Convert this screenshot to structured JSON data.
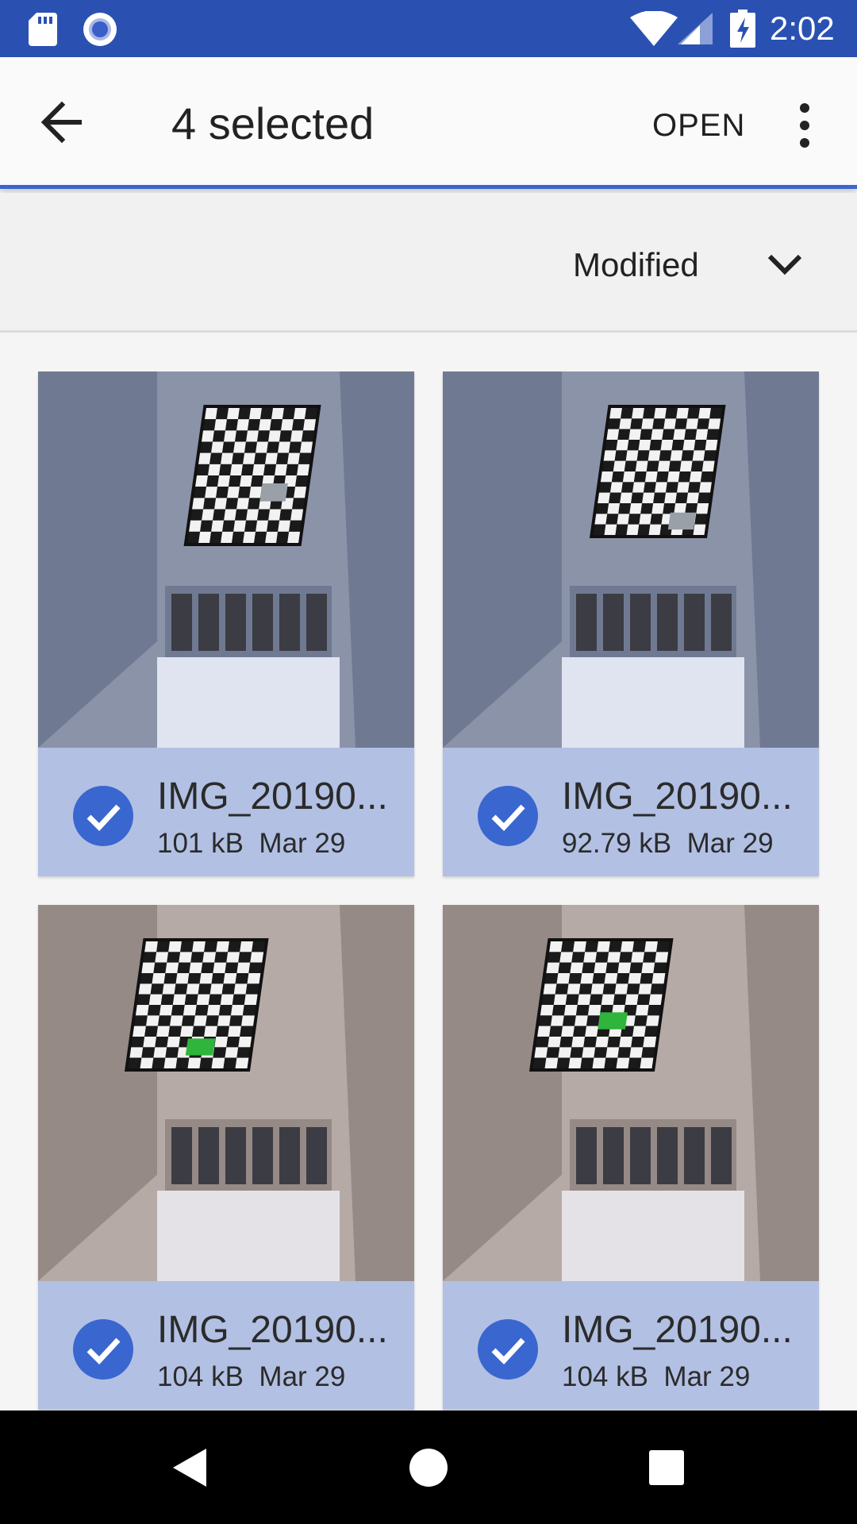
{
  "status_bar": {
    "time": "2:02",
    "icons": [
      "sd-card-icon",
      "circle-notification-icon",
      "wifi-icon",
      "cell-signal-icon",
      "battery-charging-icon"
    ]
  },
  "app_bar": {
    "title": "4 selected",
    "open_label": "OPEN",
    "accent_color": "#3a66cf"
  },
  "sort": {
    "label": "Modified"
  },
  "files": [
    {
      "name": "IMG_20190...",
      "size": "101 kB",
      "date": "Mar 29",
      "selected": true
    },
    {
      "name": "IMG_20190...",
      "size": "92.79 kB",
      "date": "Mar 29",
      "selected": true
    },
    {
      "name": "IMG_20190...",
      "size": "104 kB",
      "date": "Mar 29",
      "selected": true
    },
    {
      "name": "IMG_20190...",
      "size": "104 kB",
      "date": "Mar 29",
      "selected": true
    }
  ],
  "colors": {
    "status_bar": "#2a51b2",
    "selection_fill": "#b2c0e3",
    "check_circle": "#3a66cf"
  }
}
